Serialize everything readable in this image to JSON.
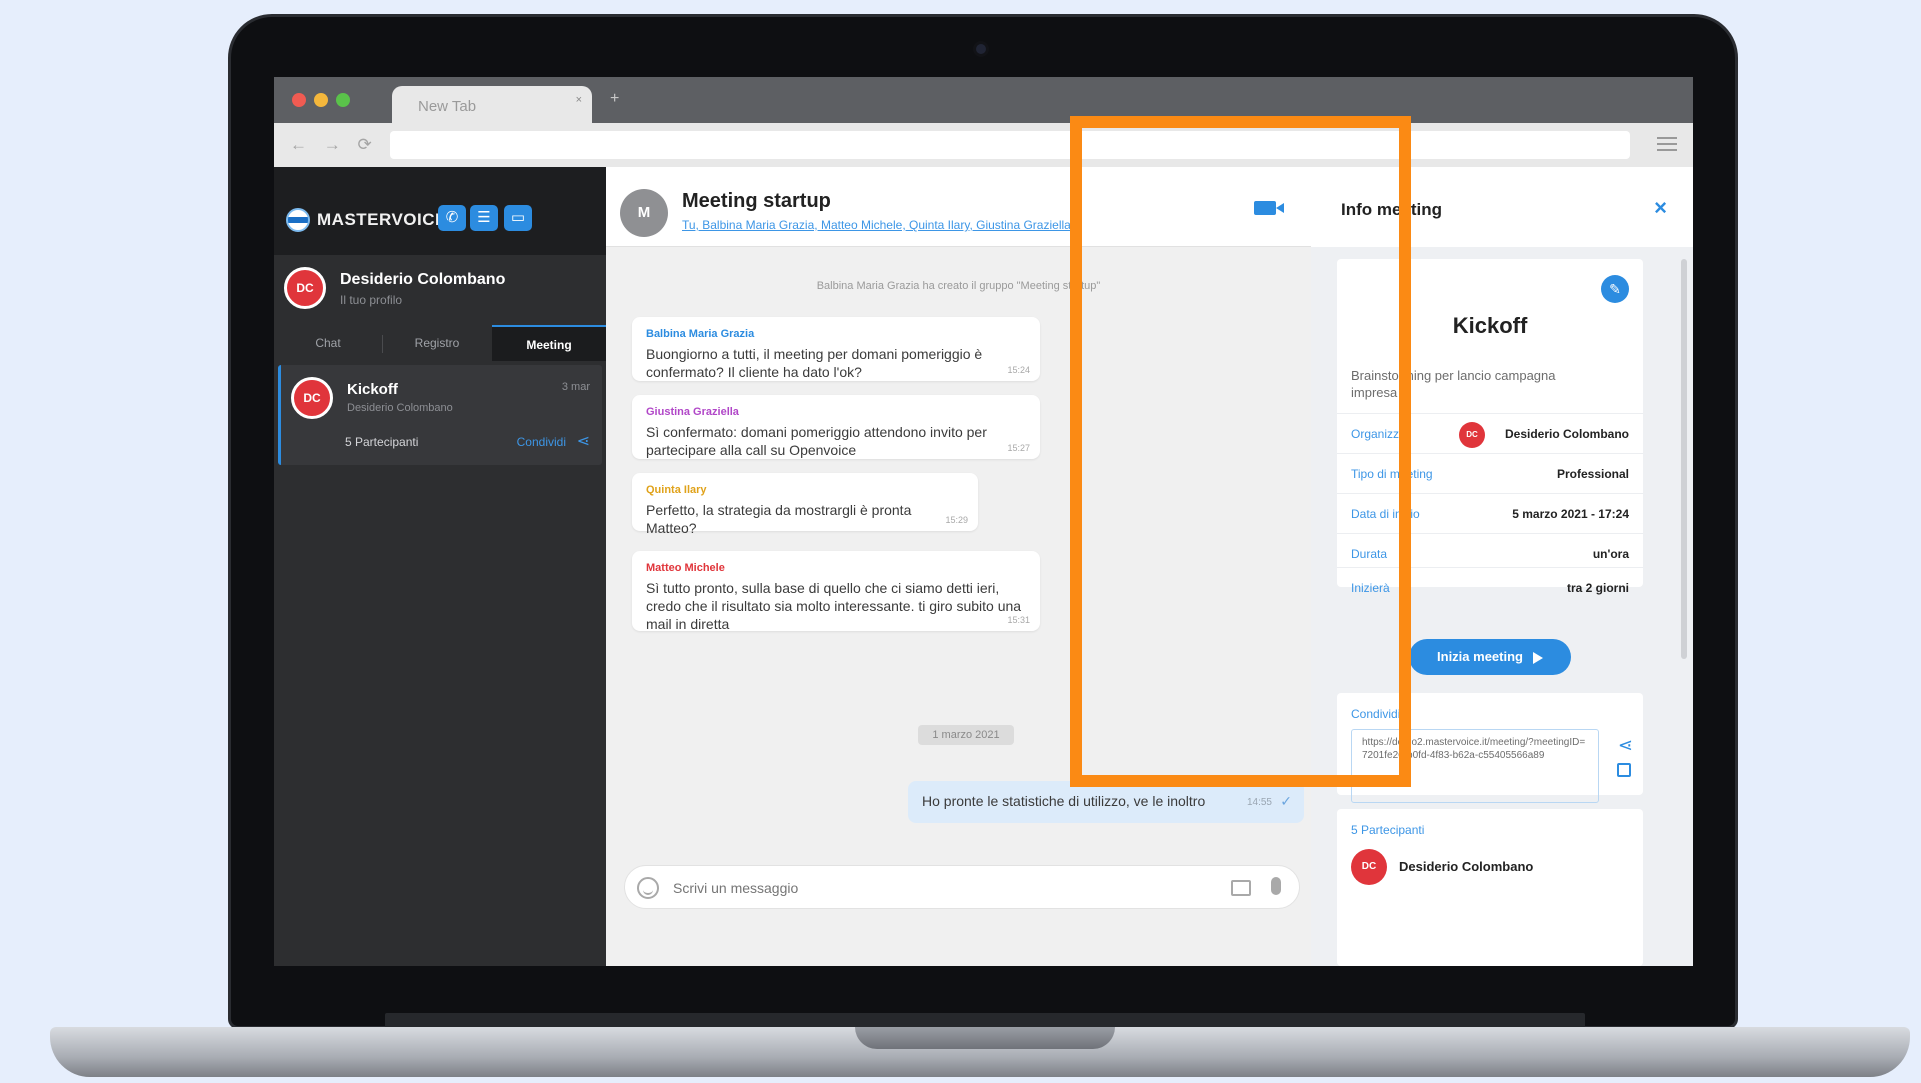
{
  "browser": {
    "tab_title": "New Tab",
    "tab_close": "×",
    "new_tab": "+",
    "nav": "← → ⟳",
    "url": ""
  },
  "sidebar": {
    "logo": "MASTERVOICE",
    "icons": [
      "phone-icon",
      "chat-icon",
      "monitor-icon"
    ],
    "profile": {
      "initials": "DC",
      "name": "Desiderio Colombano",
      "subtitle": "Il tuo profilo"
    },
    "tabs": [
      {
        "label": "Chat",
        "active": false
      },
      {
        "label": "Registro",
        "active": false
      },
      {
        "label": "Meeting",
        "active": true
      }
    ],
    "meeting_item": {
      "initials": "DC",
      "title": "Kickoff",
      "organizer": "Desiderio Colombano",
      "time": "3 mar",
      "participants": "5 Partecipanti",
      "share": "Condividi"
    }
  },
  "chat": {
    "avatar": "M",
    "title": "Meeting startup",
    "members": "Tu, Balbina Maria Grazia, Matteo Michele, Quinta Ilary, Giustina Graziella",
    "system_message": "Balbina Maria Grazia ha creato il gruppo \"Meeting startup\"",
    "messages": [
      {
        "author": "Balbina Maria Grazia",
        "color": "#2c8ce0",
        "text": "Buongiorno a tutti, il meeting per domani pomeriggio è confermato? Il cliente ha dato l'ok?",
        "time": "15:24"
      },
      {
        "author": "Giustina Graziella",
        "color": "#b147c8",
        "text": "Sì confermato: domani pomeriggio attendono invito per partecipare alla call su Openvoice",
        "time": "15:27"
      },
      {
        "author": "Quinta Ilary",
        "color": "#e0a21a",
        "text": "Perfetto, la strategia da mostrargli è pronta Matteo?",
        "time": "15:29"
      },
      {
        "author": "Matteo Michele",
        "color": "#e0353b",
        "text": "Sì tutto pronto, sulla base di quello che ci siamo detti ieri, credo che il risultato sia molto interessante. ti giro subito una mail in diretta",
        "time": "15:31"
      }
    ],
    "date_chip": "1 marzo 2021",
    "outgoing": {
      "text": "Ho pronte le statistiche di utilizzo, ve le inoltro",
      "time": "14:55",
      "check": "✓"
    },
    "composer_placeholder": "Scrivi un messaggio"
  },
  "info": {
    "title": "Info meeting",
    "close": "×",
    "meeting": {
      "edit": "✎",
      "title": "Kickoff",
      "description": "Brainstorming per lancio campagna impresa X",
      "rows": [
        {
          "label": "Organizza",
          "value": "Desiderio Colombano",
          "initials": "DC"
        },
        {
          "label": "Tipo di meeting",
          "value": "Professional"
        },
        {
          "label": "Data di inizio",
          "value": "5 marzo 2021 - 17:24"
        },
        {
          "label": "Durata",
          "value": "un'ora"
        },
        {
          "label": "Inizierà",
          "value": "tra 2 giorni"
        }
      ]
    },
    "start_button": "Inizia meeting",
    "share": {
      "label": "Condividi",
      "link": "https://demo2.mastervoice.it/meeting/?meetingID=7201fe26-b0fd-4f83-b62a-c55405566a89"
    },
    "participants": {
      "label": "5 Partecipanti",
      "first": {
        "initials": "DC",
        "name": "Desiderio Colombano"
      }
    }
  },
  "colors": {
    "accent": "#2c8ce0",
    "highlight": "#fb8a14",
    "avatar_red": "#e0353b"
  }
}
